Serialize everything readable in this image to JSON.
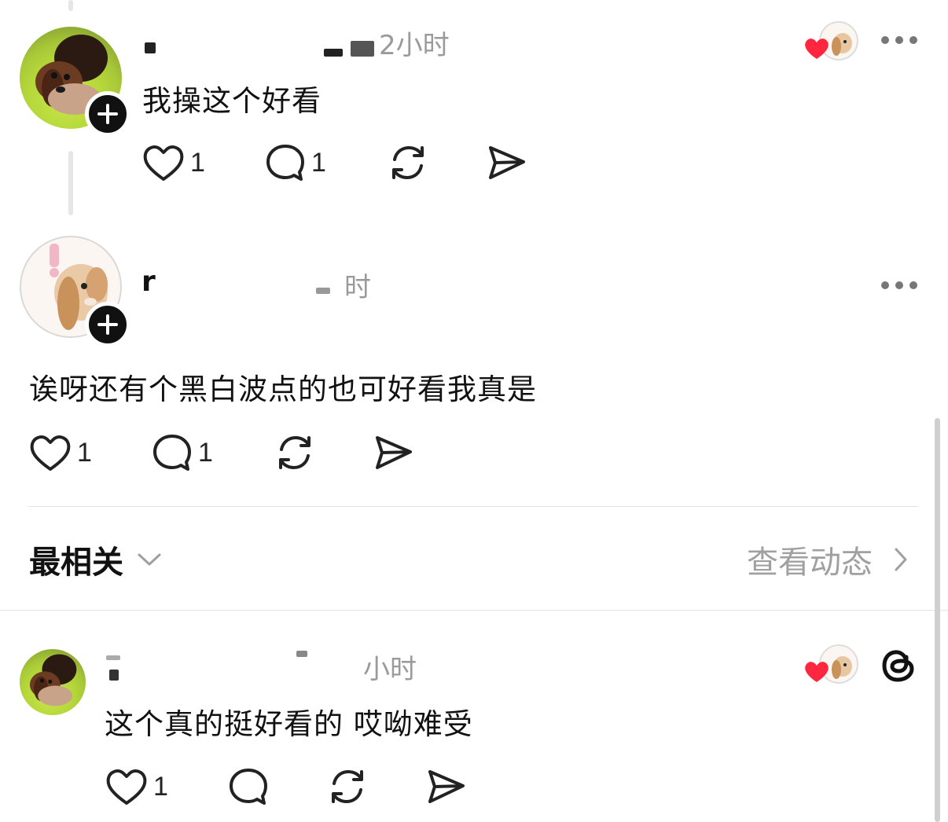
{
  "thread": [
    {
      "time": "2小时",
      "text": "我操这个好看",
      "likes": "1",
      "replies": "1"
    },
    {
      "username": "r",
      "time": "时",
      "text": "诶呀还有个黑白波点的也可好看我真是",
      "likes": "1",
      "replies": "1"
    }
  ],
  "sort_bar": {
    "label": "最相关",
    "view_activity": "查看动态"
  },
  "reply": {
    "time": "小时",
    "text": "这个真的挺好看的 哎呦难受",
    "likes": "1"
  },
  "colors": {
    "heart_liked": "#ff2740",
    "meta_gray": "#9a9a9a"
  },
  "icons": [
    "heart-icon",
    "comment-icon",
    "repost-icon",
    "share-icon",
    "more-icon",
    "plus-icon",
    "chevron-down-icon",
    "chevron-right-icon",
    "threads-logo-icon"
  ]
}
